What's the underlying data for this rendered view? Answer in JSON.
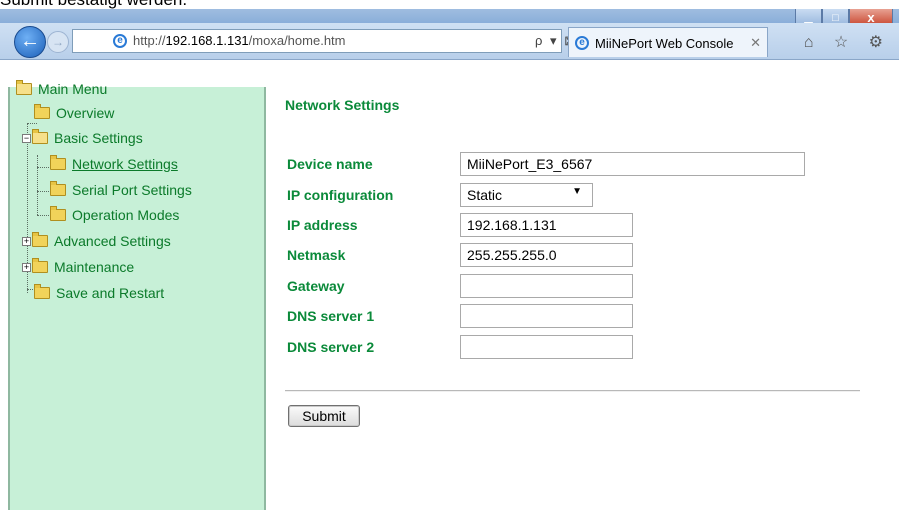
{
  "caption": "Submit bestätigt werden.",
  "browser": {
    "url_prefix": "http://",
    "url_host": "192.168.1.131",
    "url_path": "/moxa/home.htm",
    "address_tools": "ρ ▾ ⊠ ↻ ✕",
    "tab_title": "MiiNePort Web Console",
    "tab_close": "✕",
    "back_glyph": "←",
    "forward_glyph": "→",
    "nav_icons": "⌂ ☆ ⚙",
    "window_buttons": {
      "minimize": "▁",
      "maximize": "□",
      "close": "x"
    },
    "icons": [
      "back-arrow-icon",
      "forward-arrow-icon",
      "ie-logo-icon",
      "search-icon",
      "refresh-icon",
      "home-icon",
      "favorites-star-icon",
      "gear-icon"
    ]
  },
  "sidebar": {
    "items": [
      {
        "label": "Main Menu"
      },
      {
        "label": "Overview"
      },
      {
        "label": "Basic Settings",
        "expander": "−"
      },
      {
        "label": "Network Settings"
      },
      {
        "label": "Serial Port Settings"
      },
      {
        "label": "Operation Modes"
      },
      {
        "label": "Advanced Settings",
        "expander": "+"
      },
      {
        "label": "Maintenance",
        "expander": "+"
      },
      {
        "label": "Save and Restart"
      }
    ]
  },
  "form": {
    "title": "Network Settings",
    "fields": [
      {
        "label": "Device name",
        "value": "MiiNePort_E3_6567"
      },
      {
        "label": "IP configuration",
        "value": "Static"
      },
      {
        "label": "IP address",
        "value": "192.168.1.131"
      },
      {
        "label": "Netmask",
        "value": "255.255.255.0"
      },
      {
        "label": "Gateway",
        "value": ""
      },
      {
        "label": "DNS server 1",
        "value": ""
      },
      {
        "label": "DNS server 2",
        "value": ""
      }
    ],
    "submit_label": "Submit"
  },
  "colors": {
    "label_green": "#0b8a3a",
    "sidebar_bg": "#c7f0d7",
    "sidebar_text": "#0b7a2a",
    "chrome_blue": "#b9cfe8"
  }
}
